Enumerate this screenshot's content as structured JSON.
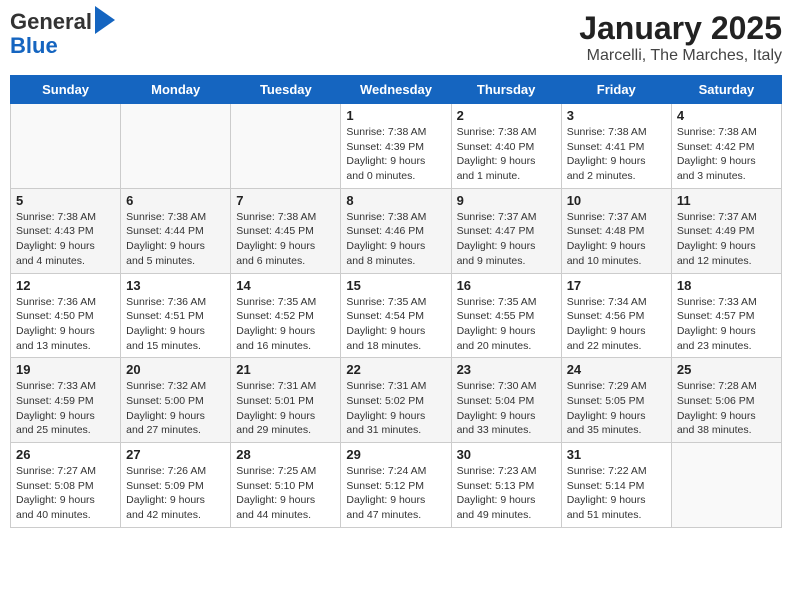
{
  "header": {
    "logo_line1": "General",
    "logo_line2": "Blue",
    "title": "January 2025",
    "subtitle": "Marcelli, The Marches, Italy"
  },
  "calendar": {
    "weekdays": [
      "Sunday",
      "Monday",
      "Tuesday",
      "Wednesday",
      "Thursday",
      "Friday",
      "Saturday"
    ],
    "weeks": [
      [
        {
          "day": "",
          "info": ""
        },
        {
          "day": "",
          "info": ""
        },
        {
          "day": "",
          "info": ""
        },
        {
          "day": "1",
          "info": "Sunrise: 7:38 AM\nSunset: 4:39 PM\nDaylight: 9 hours\nand 0 minutes."
        },
        {
          "day": "2",
          "info": "Sunrise: 7:38 AM\nSunset: 4:40 PM\nDaylight: 9 hours\nand 1 minute."
        },
        {
          "day": "3",
          "info": "Sunrise: 7:38 AM\nSunset: 4:41 PM\nDaylight: 9 hours\nand 2 minutes."
        },
        {
          "day": "4",
          "info": "Sunrise: 7:38 AM\nSunset: 4:42 PM\nDaylight: 9 hours\nand 3 minutes."
        }
      ],
      [
        {
          "day": "5",
          "info": "Sunrise: 7:38 AM\nSunset: 4:43 PM\nDaylight: 9 hours\nand 4 minutes."
        },
        {
          "day": "6",
          "info": "Sunrise: 7:38 AM\nSunset: 4:44 PM\nDaylight: 9 hours\nand 5 minutes."
        },
        {
          "day": "7",
          "info": "Sunrise: 7:38 AM\nSunset: 4:45 PM\nDaylight: 9 hours\nand 6 minutes."
        },
        {
          "day": "8",
          "info": "Sunrise: 7:38 AM\nSunset: 4:46 PM\nDaylight: 9 hours\nand 8 minutes."
        },
        {
          "day": "9",
          "info": "Sunrise: 7:37 AM\nSunset: 4:47 PM\nDaylight: 9 hours\nand 9 minutes."
        },
        {
          "day": "10",
          "info": "Sunrise: 7:37 AM\nSunset: 4:48 PM\nDaylight: 9 hours\nand 10 minutes."
        },
        {
          "day": "11",
          "info": "Sunrise: 7:37 AM\nSunset: 4:49 PM\nDaylight: 9 hours\nand 12 minutes."
        }
      ],
      [
        {
          "day": "12",
          "info": "Sunrise: 7:36 AM\nSunset: 4:50 PM\nDaylight: 9 hours\nand 13 minutes."
        },
        {
          "day": "13",
          "info": "Sunrise: 7:36 AM\nSunset: 4:51 PM\nDaylight: 9 hours\nand 15 minutes."
        },
        {
          "day": "14",
          "info": "Sunrise: 7:35 AM\nSunset: 4:52 PM\nDaylight: 9 hours\nand 16 minutes."
        },
        {
          "day": "15",
          "info": "Sunrise: 7:35 AM\nSunset: 4:54 PM\nDaylight: 9 hours\nand 18 minutes."
        },
        {
          "day": "16",
          "info": "Sunrise: 7:35 AM\nSunset: 4:55 PM\nDaylight: 9 hours\nand 20 minutes."
        },
        {
          "day": "17",
          "info": "Sunrise: 7:34 AM\nSunset: 4:56 PM\nDaylight: 9 hours\nand 22 minutes."
        },
        {
          "day": "18",
          "info": "Sunrise: 7:33 AM\nSunset: 4:57 PM\nDaylight: 9 hours\nand 23 minutes."
        }
      ],
      [
        {
          "day": "19",
          "info": "Sunrise: 7:33 AM\nSunset: 4:59 PM\nDaylight: 9 hours\nand 25 minutes."
        },
        {
          "day": "20",
          "info": "Sunrise: 7:32 AM\nSunset: 5:00 PM\nDaylight: 9 hours\nand 27 minutes."
        },
        {
          "day": "21",
          "info": "Sunrise: 7:31 AM\nSunset: 5:01 PM\nDaylight: 9 hours\nand 29 minutes."
        },
        {
          "day": "22",
          "info": "Sunrise: 7:31 AM\nSunset: 5:02 PM\nDaylight: 9 hours\nand 31 minutes."
        },
        {
          "day": "23",
          "info": "Sunrise: 7:30 AM\nSunset: 5:04 PM\nDaylight: 9 hours\nand 33 minutes."
        },
        {
          "day": "24",
          "info": "Sunrise: 7:29 AM\nSunset: 5:05 PM\nDaylight: 9 hours\nand 35 minutes."
        },
        {
          "day": "25",
          "info": "Sunrise: 7:28 AM\nSunset: 5:06 PM\nDaylight: 9 hours\nand 38 minutes."
        }
      ],
      [
        {
          "day": "26",
          "info": "Sunrise: 7:27 AM\nSunset: 5:08 PM\nDaylight: 9 hours\nand 40 minutes."
        },
        {
          "day": "27",
          "info": "Sunrise: 7:26 AM\nSunset: 5:09 PM\nDaylight: 9 hours\nand 42 minutes."
        },
        {
          "day": "28",
          "info": "Sunrise: 7:25 AM\nSunset: 5:10 PM\nDaylight: 9 hours\nand 44 minutes."
        },
        {
          "day": "29",
          "info": "Sunrise: 7:24 AM\nSunset: 5:12 PM\nDaylight: 9 hours\nand 47 minutes."
        },
        {
          "day": "30",
          "info": "Sunrise: 7:23 AM\nSunset: 5:13 PM\nDaylight: 9 hours\nand 49 minutes."
        },
        {
          "day": "31",
          "info": "Sunrise: 7:22 AM\nSunset: 5:14 PM\nDaylight: 9 hours\nand 51 minutes."
        },
        {
          "day": "",
          "info": ""
        }
      ]
    ]
  }
}
